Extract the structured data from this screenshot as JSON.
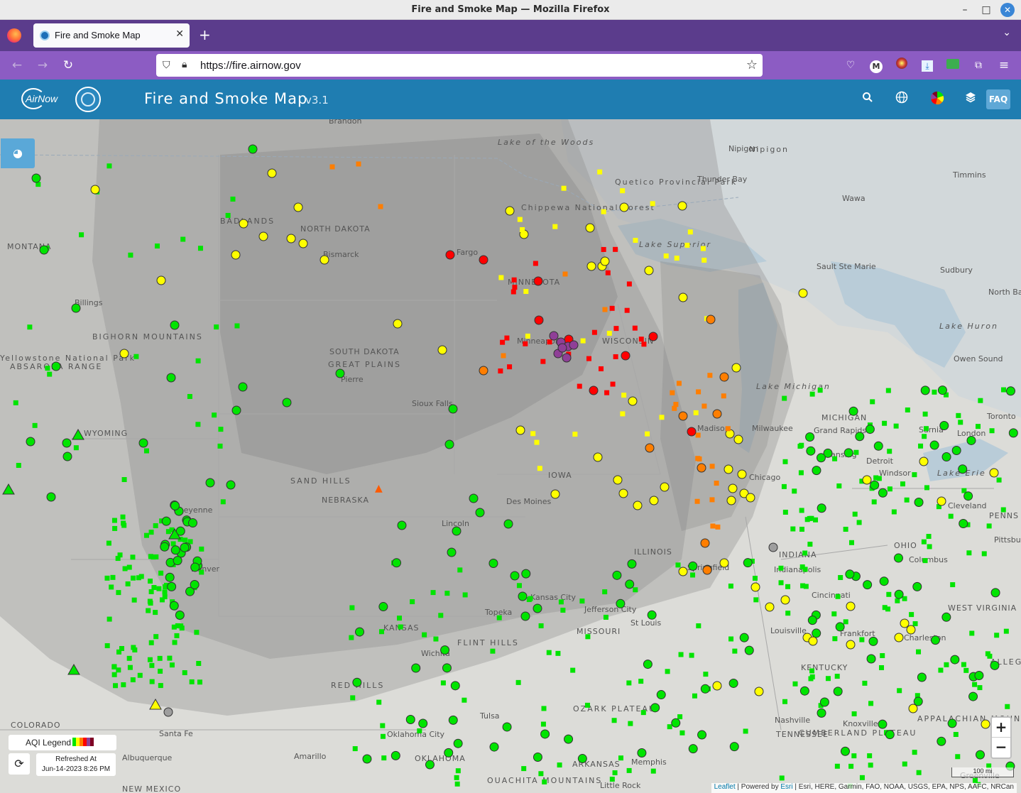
{
  "window": {
    "title": "Fire and Smoke Map — Mozilla Firefox",
    "minimize": "–",
    "maximize": "□",
    "close": "✕"
  },
  "tabs": {
    "items": [
      {
        "label": "Fire and Smoke Map",
        "close": "✕"
      }
    ],
    "new_tab": "+",
    "list_all": "⌄"
  },
  "nav": {
    "back": "←",
    "forward": "→",
    "reload": "↻",
    "url": "https://fire.airnow.gov",
    "bookmark": "☆",
    "toolbar_icons": [
      "pocket-icon",
      "account-icon",
      "extension-icon",
      "downloads-icon",
      "extension-2-icon",
      "extensions-icon",
      "menu-icon"
    ],
    "menu": "≡"
  },
  "app": {
    "logo_text": "AirNow",
    "title": "Fire and Smoke Map",
    "version": "v3.1",
    "faq": "FAQ",
    "header_icons": [
      "search-icon",
      "globe-icon",
      "aqi-pie-icon",
      "layers-icon"
    ]
  },
  "map": {
    "labels": {
      "states": [
        "NORTH DAKOTA",
        "SOUTH DAKOTA",
        "NEBRASKA",
        "KANSAS",
        "MINNESOTA",
        "IOWA",
        "MISSOURI",
        "ILLINOIS",
        "WISCONSIN",
        "MICHIGAN",
        "INDIANA",
        "OHIO",
        "KENTUCKY",
        "TENNESSEE",
        "WEST VIRGINIA",
        "WYOMING",
        "COLORADO",
        "MONTANA",
        "OKLAHOMA",
        "ARKANSAS",
        "NEW MEXICO",
        "PENNS"
      ],
      "cities": [
        "Brandon",
        "Bismarck",
        "Fargo",
        "Billings",
        "Pierre",
        "Sioux Falls",
        "Minneapolis",
        "Des Moines",
        "Lincoln",
        "Cheyenne",
        "Denver",
        "Topeka",
        "Kansas City",
        "Wichita",
        "Tulsa",
        "Oklahoma City",
        "Amarillo",
        "Santa Fe",
        "Albuquerque",
        "Jefferson City",
        "St Louis",
        "Springfield",
        "Chicago",
        "Milwaukee",
        "Madison",
        "Indianapolis",
        "Cincinnati",
        "Columbus",
        "Louisville",
        "Frankfort",
        "Nashville",
        "Knoxville",
        "Charleston",
        "Lansing",
        "Grand Rapids",
        "Detroit",
        "Windsor",
        "Sarnia",
        "London",
        "Toronto",
        "Cleveland",
        "Pittsburgh",
        "Thunder Bay",
        "Nipigon",
        "Timmins",
        "Wawa",
        "Sault Ste Marie",
        "Sudbury",
        "North Bay",
        "Owen Sound",
        "Memphis",
        "Little Rock",
        "Greenville"
      ],
      "features": [
        "GREAT PLAINS",
        "SAND HILLS",
        "FLINT HILLS",
        "RED HILLS",
        "OZARK PLATEAU",
        "OUACHITA MOUNTAINS",
        "BIGHORN MOUNTAINS",
        "ABSAROKA RANGE",
        "BADLANDS",
        "CUMBERLAND PLATEAU",
        "APPALACHIAN MOUNTAINS",
        "ALLEGHENY",
        "Lake Superior",
        "Lake Michigan",
        "Lake Huron",
        "Lake Erie",
        "Lake of the Woods",
        "Quetico Provincial Park",
        "Chippewa National Forest",
        "Nipigon",
        "Yellowstone National Park"
      ]
    },
    "aqi_colors": {
      "good": "#00e400",
      "moderate": "#ffff00",
      "usg": "#ff7e00",
      "unhealthy": "#ff0000",
      "very_unhealthy": "#8f3f97",
      "hazardous": "#7e0023",
      "no_data": "#9e9e9e"
    }
  },
  "controls": {
    "zoom_in": "+",
    "zoom_out": "−",
    "legend_label": "AQI Legend",
    "refreshed_label": "Refreshed At",
    "refreshed_time": "Jun-14-2023 8:26 PM",
    "scale_label": "100 mi"
  },
  "attribution": {
    "leaflet": "Leaflet",
    "powered": " | Powered by ",
    "esri": "Esri",
    "sources": " | Esri, HERE, Garmin, FAO, NOAA, USGS, EPA, NPS, AAFC, NRCan"
  }
}
